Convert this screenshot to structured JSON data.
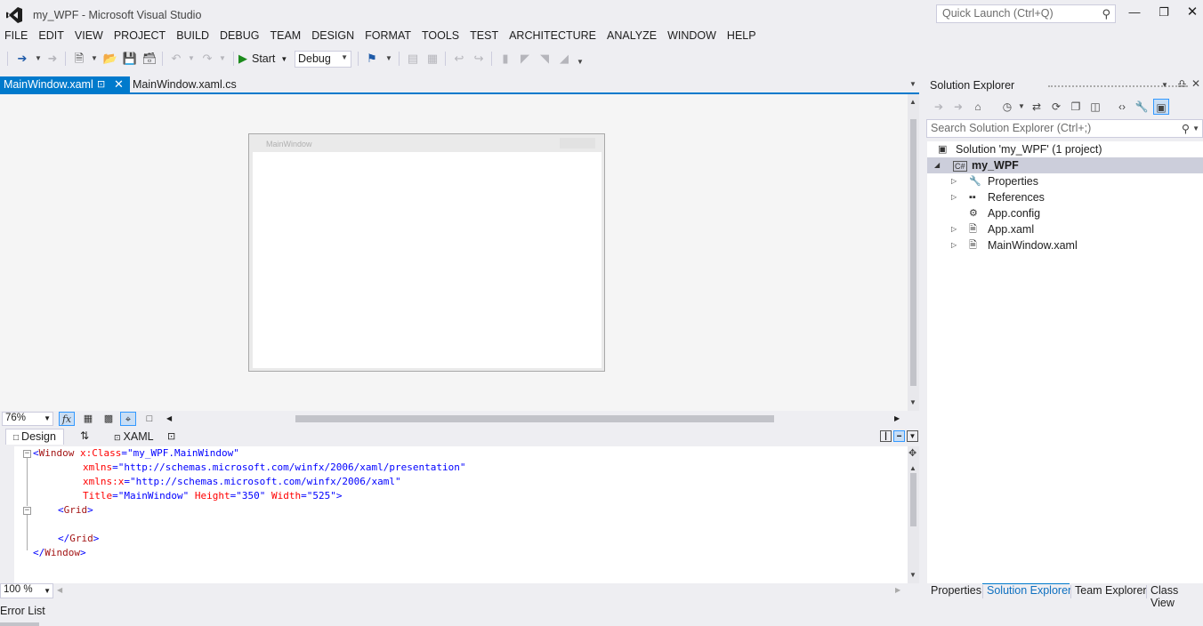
{
  "window": {
    "title": "my_WPF - Microsoft Visual Studio",
    "quick_launch_placeholder": "Quick Launch (Ctrl+Q)"
  },
  "menu": [
    "FILE",
    "EDIT",
    "VIEW",
    "PROJECT",
    "BUILD",
    "DEBUG",
    "TEAM",
    "DESIGN",
    "FORMAT",
    "TOOLS",
    "TEST",
    "ARCHITECTURE",
    "ANALYZE",
    "WINDOW",
    "HELP"
  ],
  "toolbar": {
    "start_label": "Start",
    "config_value": "Debug"
  },
  "tabs": {
    "active": "MainWindow.xaml",
    "second": "MainWindow.xaml.cs"
  },
  "designer": {
    "window_title": "MainWindow",
    "zoom": "76%"
  },
  "split": {
    "design_label": "Design",
    "xaml_label": "XAML"
  },
  "code": {
    "line1": {
      "open": "<",
      "tag": "Window",
      "attr": " x:Class",
      "eq": "=",
      "val": "\"my_WPF.MainWindow\""
    },
    "line2": {
      "attr": "xmlns",
      "eq": "=",
      "val": "\"http://schemas.microsoft.com/winfx/2006/xaml/presentation\""
    },
    "line3": {
      "attr": "xmlns:x",
      "eq": "=",
      "val": "\"http://schemas.microsoft.com/winfx/2006/xaml\""
    },
    "line4": {
      "attr1": "Title",
      "val1": "\"MainWindow\"",
      "attr2": " Height",
      "val2": "\"350\"",
      "attr3": " Width",
      "val3": "\"525\"",
      "close": ">"
    },
    "line5": {
      "open": "<",
      "tag": "Grid",
      "close": ">"
    },
    "line7": {
      "open": "</",
      "tag": "Grid",
      "close": ">"
    },
    "line8": {
      "open": "</",
      "tag": "Window",
      "close": ">"
    },
    "eq": "="
  },
  "editor": {
    "zoom": "100 %"
  },
  "bottom": {
    "error_list": "Error List"
  },
  "solution_explorer": {
    "title": "Solution Explorer",
    "search_placeholder": "Search Solution Explorer (Ctrl+;)",
    "solution": "Solution 'my_WPF' (1 project)",
    "project": "my_WPF",
    "items": [
      "Properties",
      "References",
      "App.config",
      "App.xaml",
      "MainWindow.xaml"
    ]
  },
  "panel_tabs": [
    "Properties",
    "Solution Explorer",
    "Team Explorer",
    "Class View"
  ],
  "colors": {
    "accent": "#007acc",
    "background": "#eeeef2",
    "xml_tag": "#a31515",
    "xml_attr": "#ff0000",
    "xml_value": "#0000ff"
  }
}
